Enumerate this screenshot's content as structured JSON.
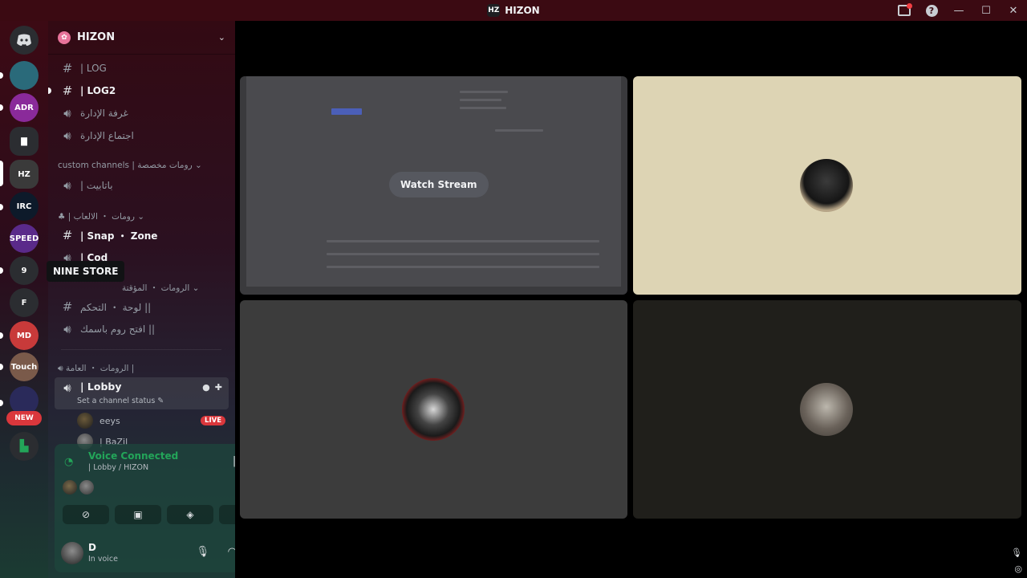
{
  "window": {
    "title": "HIZON"
  },
  "titlebar": {
    "minimize": "—",
    "maximize": "☐",
    "close": "✕",
    "help": "?"
  },
  "rail": {
    "home_icon": "discord-logo-icon",
    "new_label": "NEW",
    "tooltip": "NINE STORE",
    "servers": [
      {
        "abbr": "",
        "color": "#2a6a7a"
      },
      {
        "abbr": "ADR",
        "color": "#8a2a9a"
      },
      {
        "abbr": "▇",
        "color": "#2b2d31"
      },
      {
        "abbr": "HZ",
        "color": "#3a3a3a"
      },
      {
        "abbr": "IRC",
        "color": "#0d1a2a"
      },
      {
        "abbr": "SPEED",
        "color": "#5a2a8a"
      },
      {
        "abbr": "9",
        "color": "#2b2d31"
      },
      {
        "abbr": "F",
        "color": "#2b2d31"
      },
      {
        "abbr": "MD",
        "color": "#c83a3a"
      },
      {
        "abbr": "Touch",
        "color": "#7a5a4a"
      },
      {
        "abbr": "",
        "color": "#2a2a5a"
      }
    ]
  },
  "guild": {
    "name": "HIZON"
  },
  "channels": {
    "log": "| LOG",
    "log2": "| LOG2",
    "admin_room": "غرفة الإدارة",
    "admin_meeting": "اجتماع الإدارة",
    "cat_custom": "custom channels | رومات مخصصة",
    "batabit": "| باتابيت",
    "cat_games": "| رومات ・ الالعاب",
    "snap_zone": "| Snap ・ Zone",
    "cod": "| Cod",
    "cat_temp": "الرومات ・ المؤقتة",
    "control_panel": "لوحة ・ التحكم ||",
    "open_room": "افتح روم باسمك ||",
    "cat_general": "الرومات ・ العامة |",
    "lobby": "| Lobby",
    "lobby_status": "Set a channel status",
    "members": [
      {
        "name": "eeys",
        "badge": "LIVE"
      },
      {
        "name": "| BaZil",
        "badge": ""
      }
    ]
  },
  "voice": {
    "status": "Voice Connected",
    "location": "| Lobby / HIZON",
    "actions": [
      "camera-off-icon",
      "screen-share-icon",
      "activity-icon",
      "soundboard-icon"
    ]
  },
  "user": {
    "name": "D",
    "status": "In voice"
  },
  "stage": {
    "watch_stream": "Watch Stream"
  }
}
